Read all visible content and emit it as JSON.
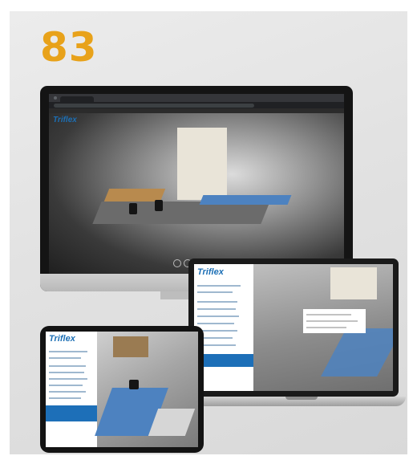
{
  "page_number": "83",
  "brand": {
    "logo_text": "Triflex",
    "tagline": ""
  },
  "colors": {
    "accent_number": "#e8a21a",
    "brand_blue": "#1c6fb5"
  },
  "devices": [
    "desktop-monitor",
    "laptop",
    "tablet"
  ]
}
